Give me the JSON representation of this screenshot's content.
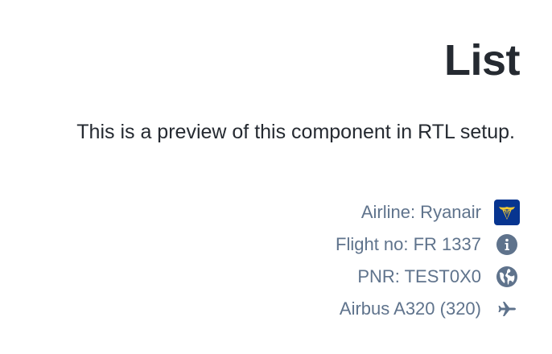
{
  "page": {
    "title": "List",
    "description": ".This is a preview of this component in RTL setup"
  },
  "list": {
    "items": [
      {
        "label": "Airline: Ryanair",
        "icon": "ryanair-logo-icon"
      },
      {
        "label": "Flight no: FR 1337",
        "icon": "info-circle-icon"
      },
      {
        "label": "PNR: TEST0X0",
        "icon": "globe-icon"
      },
      {
        "label": "Airbus A320 (320)",
        "icon": "airplane-icon"
      }
    ]
  },
  "colors": {
    "heading": "#252a31",
    "secondary_text": "#5f738c",
    "icon": "#5f738c",
    "ryanair_blue": "#073590",
    "ryanair_gold": "#f1c933"
  }
}
